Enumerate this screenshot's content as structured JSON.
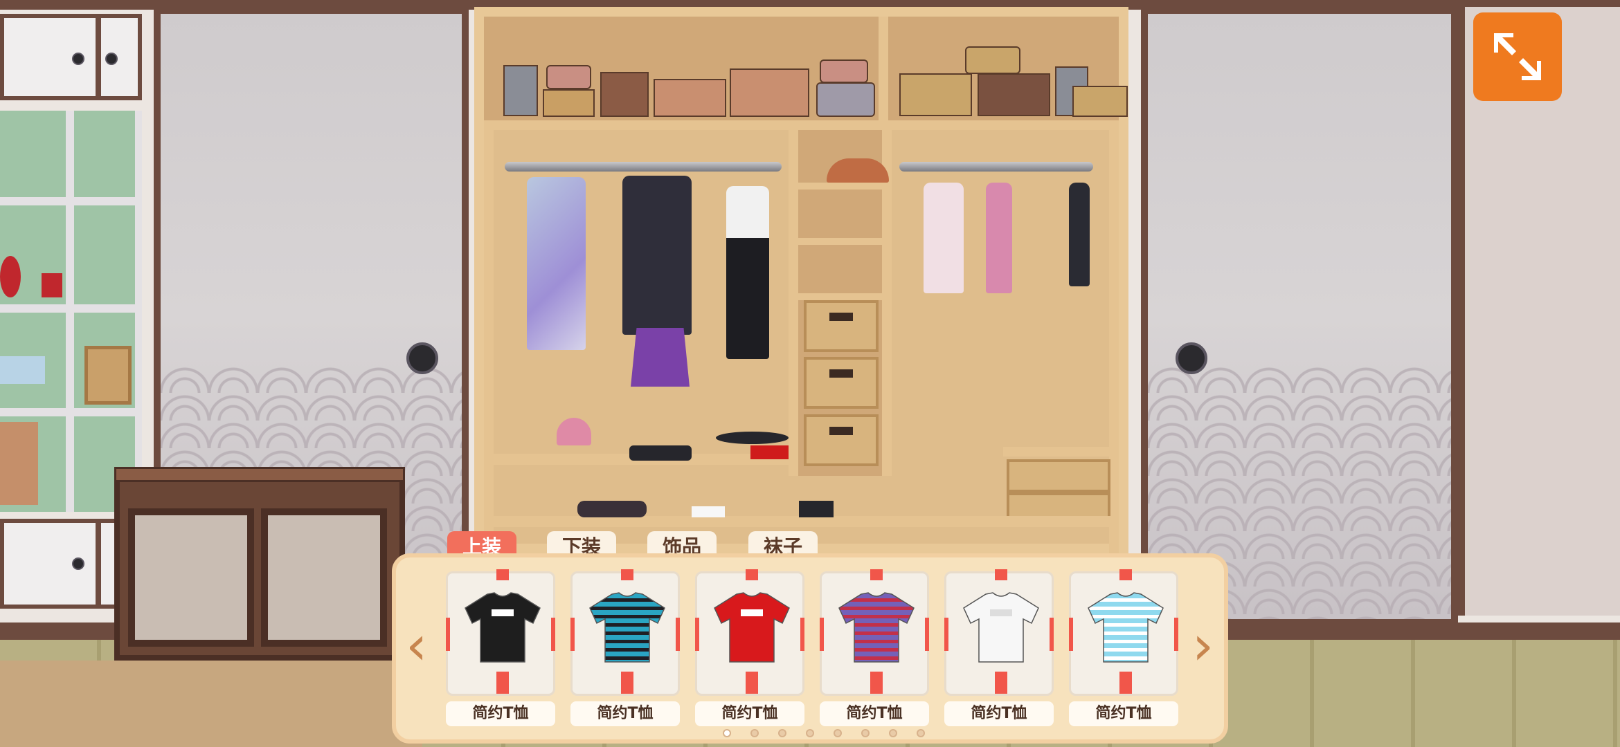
{
  "hud": {
    "minimize_icon": "collapse-arrows-icon"
  },
  "wardrobe": {
    "tabs": [
      {
        "label": "上装",
        "active": true
      },
      {
        "label": "下装",
        "active": false
      },
      {
        "label": "饰品",
        "active": false
      },
      {
        "label": "袜子",
        "active": false
      }
    ],
    "items": [
      {
        "name": "简约T恤",
        "color": "#1e1e1e",
        "pattern": "solid-logo"
      },
      {
        "name": "简约T恤",
        "color": "#2aa5c3",
        "pattern": "stripes-dark"
      },
      {
        "name": "简约T恤",
        "color": "#d8191c",
        "pattern": "solid-logo"
      },
      {
        "name": "简约T恤",
        "color": "#7461b8",
        "pattern": "stripes-red"
      },
      {
        "name": "简约T恤",
        "color": "#f7f7f7",
        "pattern": "solid-logo"
      },
      {
        "name": "简约T恤",
        "color": "#8fd9ee",
        "pattern": "stripes-light"
      }
    ],
    "prev_icon": "chevron-left-icon",
    "next_icon": "chevron-right-icon",
    "page_count": 8,
    "current_page": 1
  }
}
